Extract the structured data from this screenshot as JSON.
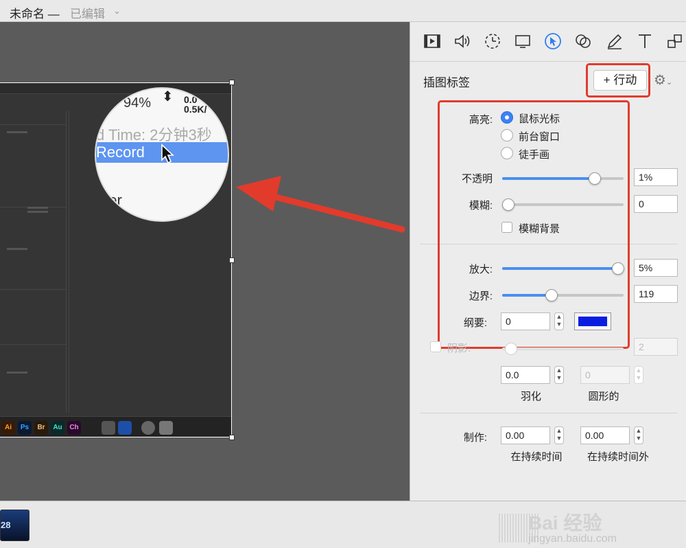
{
  "window": {
    "title": "未命名 —",
    "status": "已编辑"
  },
  "magnifier": {
    "percent": "94%",
    "rate_up": "0.0",
    "rate_down": "0.5K/",
    "time_text": "d Time: 2分钟3秒",
    "selected_item": "Record",
    "below_item": "rker"
  },
  "dock": {
    "icons": [
      "Ai",
      "Ps",
      "Br",
      "Au",
      "Ch"
    ]
  },
  "clip": {
    "number": "28"
  },
  "watermark": {
    "logo": "Bai 经验",
    "url": "jingyan.baidu.com"
  },
  "inspector": {
    "toolbar_icons": [
      "film-icon",
      "audio-icon",
      "timer-icon",
      "screen-icon",
      "cursor-icon",
      "shapes-icon",
      "pen-icon",
      "text-icon",
      "arrange-icon"
    ],
    "section_title": "插图标签",
    "action_button": "+ 行动",
    "highlight": {
      "label": "高亮:",
      "options": [
        "鼠标光标",
        "前台窗口",
        "徒手画"
      ],
      "selected": "鼠标光标"
    },
    "opacity": {
      "label": "不透明",
      "value": "1%",
      "level": 0.88
    },
    "blur": {
      "label": "模糊:",
      "value": "0",
      "level": 0.0
    },
    "blur_background": {
      "label": "模糊背景",
      "checked": false
    },
    "zoom": {
      "label": "放大:",
      "value": "5%",
      "level": 1.0
    },
    "border": {
      "label": "边界:",
      "value": "119",
      "level": 0.4
    },
    "outline": {
      "label": "纲要:",
      "value": "0",
      "color": "#0a1ee0"
    },
    "shadow": {
      "label": "阴影:",
      "value": "2",
      "enabled": false
    },
    "feather": {
      "label": "羽化",
      "value": "0.0"
    },
    "round": {
      "label": "圆形的",
      "value": "0"
    },
    "make": {
      "label": "制作:",
      "in_value": "0.00",
      "in_label": "在持续时间",
      "out_value": "0.00",
      "out_label": "在持续时间外"
    }
  },
  "colors": {
    "accent": "#4a8ef0",
    "annotation_red": "#e23b2c"
  }
}
